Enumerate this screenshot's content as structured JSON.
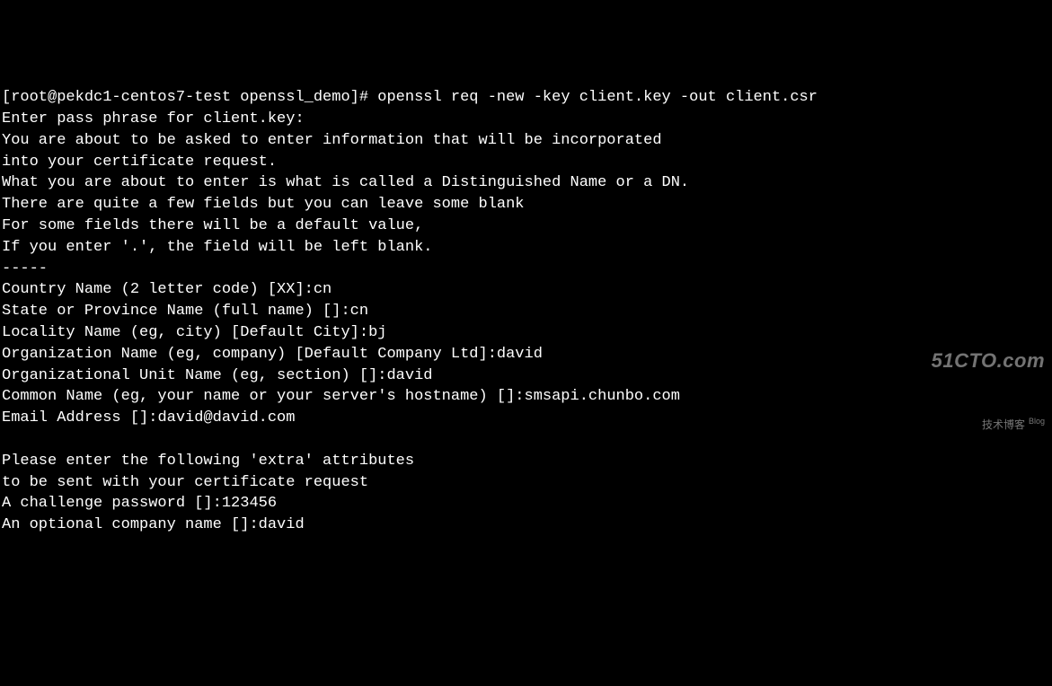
{
  "prompt": {
    "prefix": "[root@pekdc1-centos7-test openssl_demo]# ",
    "command": "openssl req -new -key client.key -out client.csr"
  },
  "lines": {
    "enter_pass": "Enter pass phrase for client.key:",
    "intro1": "You are about to be asked to enter information that will be incorporated",
    "intro2": "into your certificate request.",
    "intro3": "What you are about to enter is what is called a Distinguished Name or a DN.",
    "intro4": "There are quite a few fields but you can leave some blank",
    "intro5": "For some fields there will be a default value,",
    "intro6": "If you enter '.', the field will be left blank.",
    "divider": "-----"
  },
  "fields": {
    "country": {
      "prompt": "Country Name (2 letter code) [XX]:",
      "value": "cn"
    },
    "state": {
      "prompt": "State or Province Name (full name) []:",
      "value": "cn"
    },
    "locality": {
      "prompt": "Locality Name (eg, city) [Default City]:",
      "value": "bj"
    },
    "org": {
      "prompt": "Organization Name (eg, company) [Default Company Ltd]:",
      "value": "david"
    },
    "ou": {
      "prompt": "Organizational Unit Name (eg, section) []:",
      "value": "david"
    },
    "cn": {
      "prompt": "Common Name (eg, your name or your server's hostname) []:",
      "value": "smsapi.chunbo.com"
    },
    "email": {
      "prompt": "Email Address []:",
      "value": "david@david.com"
    }
  },
  "extra": {
    "header1": "Please enter the following 'extra' attributes",
    "header2": "to be sent with your certificate request",
    "challenge": {
      "prompt": "A challenge password []:",
      "value": "123456"
    },
    "company": {
      "prompt": "An optional company name []:",
      "value": "david"
    }
  },
  "watermark": {
    "brand": "51CTO.com",
    "sub": "技术博客",
    "blog": "Blog"
  }
}
